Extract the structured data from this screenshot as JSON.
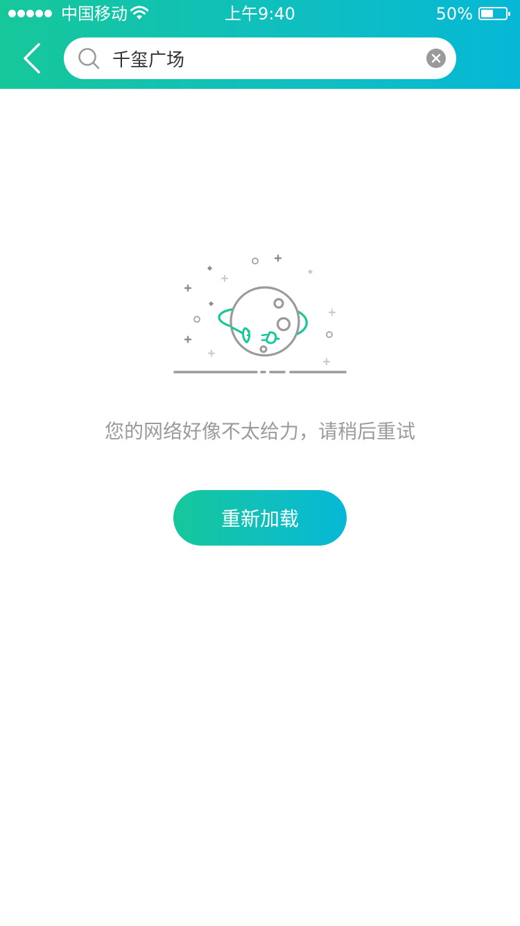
{
  "statusbar": {
    "carrier": "中国移动",
    "time": "上午9:40",
    "battery_percent": "50%",
    "battery_level": 0.5
  },
  "header": {
    "search": {
      "value": "千玺广场"
    }
  },
  "empty_state": {
    "message": "您的网络好像不太给力，请稍后重试",
    "reload_label": "重新加载"
  },
  "colors": {
    "accent_start": "#16c79a",
    "accent_end": "#06b8d6",
    "planet_ring": "#16c79a",
    "planet": "#9a9a9a",
    "message_text": "#9b9b9b"
  },
  "icons": {
    "back": "chevron-left-icon",
    "search": "search-icon",
    "clear": "clear-icon",
    "illustration": "planet-unplugged-illustration"
  }
}
